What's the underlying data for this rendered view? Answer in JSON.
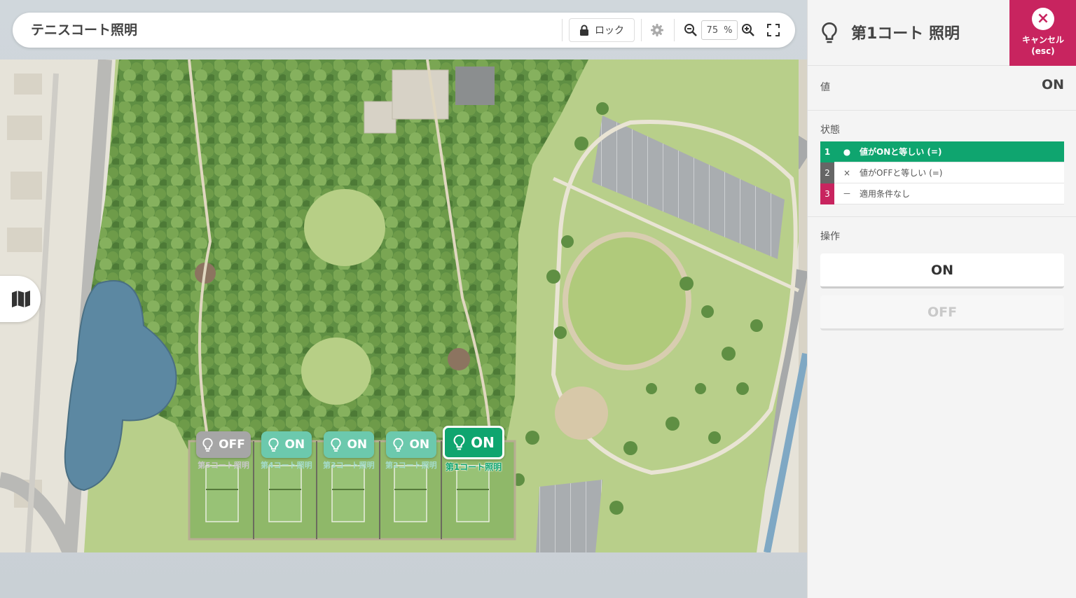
{
  "toolbar": {
    "title": "テニスコート照明",
    "lock_label": "ロック",
    "zoom_value": "75",
    "zoom_unit": "%"
  },
  "markers": [
    {
      "state": "OFF",
      "label": "第5コート照明",
      "color": "#a6a6a6"
    },
    {
      "state": "ON",
      "label": "第4コート照明",
      "color": "#6cc9ad"
    },
    {
      "state": "ON",
      "label": "第3コート照明",
      "color": "#6cc9ad"
    },
    {
      "state": "ON",
      "label": "第2コート照明",
      "color": "#6cc9ad"
    },
    {
      "state": "ON",
      "label": "第1コート照明",
      "color": "#0fa56f",
      "selected": true
    }
  ],
  "panel": {
    "title": "第1コート 照明",
    "cancel_label": "キャンセル",
    "cancel_hint": "(esc)",
    "value_label": "値",
    "value": "ON",
    "status_label": "状態",
    "conditions": [
      {
        "num": "1",
        "symbol": "●",
        "text": "値がONと等しい (=)",
        "color": "#0fa56f",
        "active": true
      },
      {
        "num": "2",
        "symbol": "×",
        "text": "値がOFFと等しい (=)",
        "color": "#666666",
        "active": false
      },
      {
        "num": "3",
        "symbol": "－",
        "text": "適用条件なし",
        "color": "#c8245f",
        "active": false
      }
    ],
    "operation_label": "操作",
    "op_on": "ON",
    "op_off": "OFF"
  },
  "colors": {
    "accent": "#0fa56f",
    "cancel": "#c8245f",
    "off": "#a6a6a6",
    "on_light": "#6cc9ad"
  }
}
